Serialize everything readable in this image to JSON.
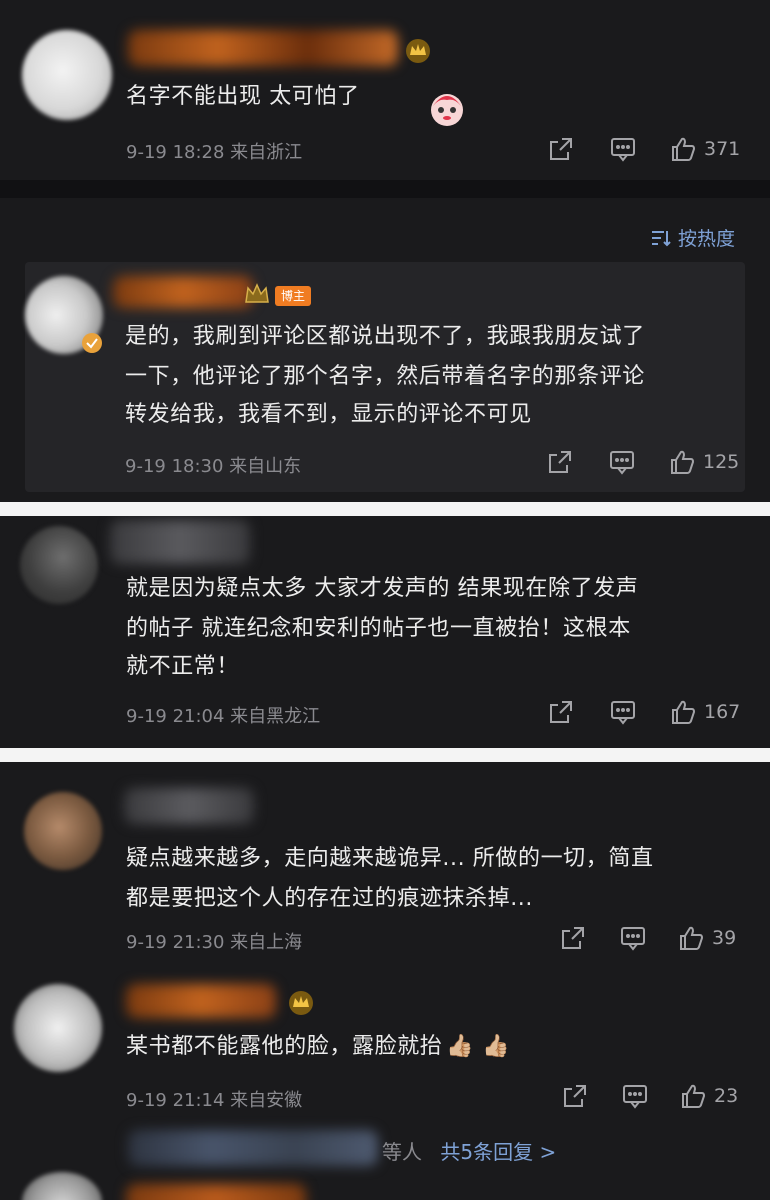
{
  "colors": {
    "background": "#1a1a1c",
    "reply_card": "#252528",
    "text": "#ececec",
    "meta": "#8a8a8f",
    "link": "#7fa2d6",
    "host_badge": "#f07c22"
  },
  "sort": {
    "label": "按热度",
    "icon": "sort-lines-icon"
  },
  "comments": [
    {
      "text_lines": [
        "名字不能出现 太可怕了"
      ],
      "meta": "9-19 18:28  来自浙江",
      "likes": "371"
    },
    {
      "host_badge": "博主",
      "text_lines": [
        "是的，我刷到评论区都说出现不了，我跟我朋友试了",
        "一下，他评论了那个名字，然后带着名字的那条评论",
        "转发给我，我看不到，显示的评论不可见"
      ],
      "meta": "9-19 18:30  来自山东",
      "likes": "125"
    },
    {
      "text_lines": [
        "就是因为疑点太多 大家才发声的 结果现在除了发声",
        "的帖子 就连纪念和安利的帖子也一直被抬！这根本",
        "就不正常！"
      ],
      "meta": "9-19 21:04  来自黑龙江",
      "likes": "167"
    },
    {
      "text_lines": [
        "疑点越来越多，走向越来越诡异... 所做的一切，简直",
        "都是要把这个人的存在过的痕迹抹杀掉..."
      ],
      "meta": "9-19 21:30  来自上海",
      "likes": "39"
    },
    {
      "text_lines": [
        "某书都不能露他的脸，露脸就抬"
      ],
      "emoji": "👍🏼 👍🏼",
      "meta": "9-19 21:14  来自安徽",
      "likes": "23"
    }
  ],
  "more_replies": {
    "prefix": "等人",
    "link": "共5条回复 >"
  }
}
